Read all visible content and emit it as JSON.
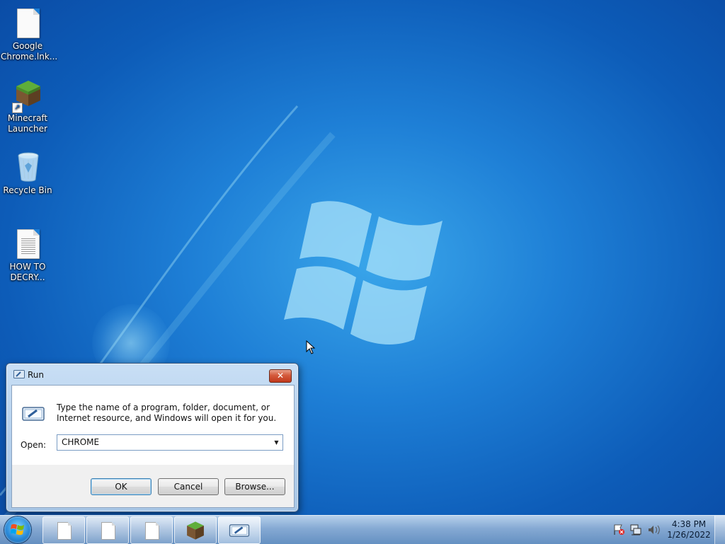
{
  "desktop": {
    "icons": [
      {
        "label": "Google Chrome.lnk...",
        "icon": "document-icon"
      },
      {
        "label": "Minecraft Launcher",
        "icon": "minecraft-grass-block-icon"
      },
      {
        "label": "Recycle Bin",
        "icon": "recycle-bin-icon"
      },
      {
        "label": "HOW TO DECRY...",
        "icon": "text-document-icon"
      }
    ]
  },
  "run_dialog": {
    "title": "Run",
    "description": "Type the name of a program, folder, document, or Internet resource, and Windows will open it for you.",
    "open_label": "Open:",
    "open_value": "CHROME",
    "ok_label": "OK",
    "cancel_label": "Cancel",
    "browse_label": "Browse...",
    "close_glyph": "✕"
  },
  "taskbar": {
    "start_icon": "windows-start-orb",
    "buttons": [
      {
        "icon": "document-icon"
      },
      {
        "icon": "document-icon"
      },
      {
        "icon": "document-icon"
      },
      {
        "icon": "minecraft-grass-block-icon"
      },
      {
        "icon": "run-dialog-icon",
        "active": true
      }
    ],
    "tray_icons": [
      "action-center-flag-icon",
      "network-icon",
      "volume-icon"
    ],
    "time": "4:38 PM",
    "date": "1/26/2022"
  },
  "colors": {
    "desktop_blue": "#1e7fd6",
    "close_red": "#c0391c",
    "ok_focus_border": "#3c7fb1"
  }
}
